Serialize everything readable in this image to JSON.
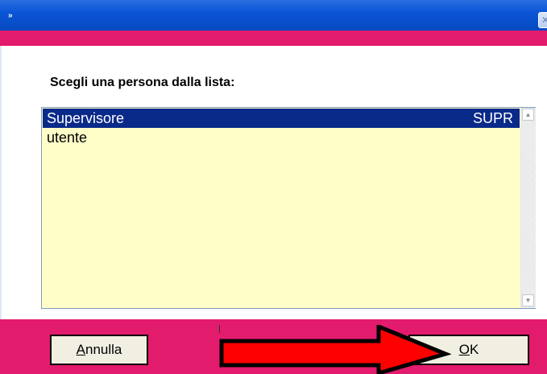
{
  "window": {
    "title_icon": "»",
    "close_icon": "close-icon",
    "titlebar_color": "#0a55d8",
    "accent_color": "#e31b6d"
  },
  "dialog": {
    "prompt": "Scegli una persona dalla lista:",
    "list": {
      "items": [
        {
          "name": "Supervisore",
          "code": "SUPR",
          "selected": true
        },
        {
          "name": "utente",
          "code": "",
          "selected": false
        }
      ],
      "background": "#fffec9",
      "selected_background": "#0a2a8a"
    }
  },
  "buttons": {
    "cancel": {
      "mnemonic": "A",
      "rest": "nnulla"
    },
    "ok": {
      "mnemonic": "O",
      "rest": "K"
    }
  },
  "annotation": {
    "icon": "red-arrow-icon",
    "fill": "#ff0000"
  }
}
